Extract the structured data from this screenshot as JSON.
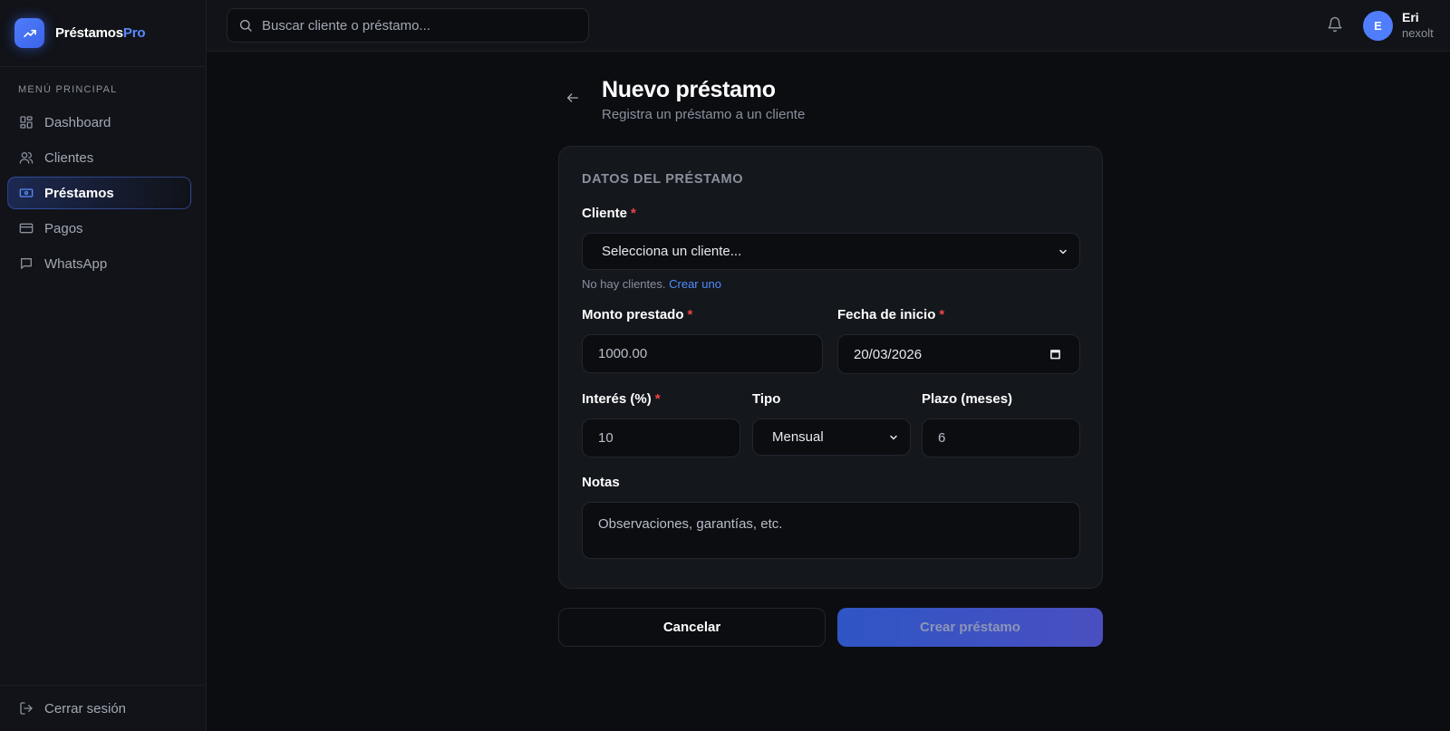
{
  "brand": {
    "name_main": "Préstamos",
    "name_accent": "Pro"
  },
  "sidebar": {
    "section_title": "MENÚ PRINCIPAL",
    "items": [
      {
        "label": "Dashboard",
        "icon": "dashboard-icon"
      },
      {
        "label": "Clientes",
        "icon": "users-icon"
      },
      {
        "label": "Préstamos",
        "icon": "banknote-icon",
        "active": true
      },
      {
        "label": "Pagos",
        "icon": "credit-card-icon"
      },
      {
        "label": "WhatsApp",
        "icon": "message-icon"
      }
    ],
    "logout_label": "Cerrar sesión"
  },
  "topbar": {
    "search_placeholder": "Buscar cliente o préstamo...",
    "user": {
      "initial": "E",
      "name": "Eri",
      "org": "nexolt"
    }
  },
  "page": {
    "title": "Nuevo préstamo",
    "subtitle": "Registra un préstamo a un cliente"
  },
  "form": {
    "section_title": "DATOS DEL PRÉSTAMO",
    "cliente": {
      "label": "Cliente",
      "value": "Selecciona un cliente...",
      "hint_text": "No hay clientes.",
      "hint_link": "Crear uno"
    },
    "monto": {
      "label": "Monto prestado",
      "placeholder": "1000.00"
    },
    "fecha": {
      "label": "Fecha de inicio",
      "value": "20/03/2026"
    },
    "interes": {
      "label": "Interés (%)",
      "placeholder": "10"
    },
    "tipo": {
      "label": "Tipo",
      "value": "Mensual"
    },
    "plazo": {
      "label": "Plazo (meses)",
      "placeholder": "6"
    },
    "notas": {
      "label": "Notas",
      "placeholder": "Observaciones, garantías, etc."
    },
    "required_mark": "*"
  },
  "actions": {
    "cancel_label": "Cancelar",
    "create_label": "Crear préstamo"
  },
  "colors": {
    "background": "#0b0d11",
    "panel": "#14171c",
    "accent": "#4f7dfb",
    "link": "#4f8cff",
    "required": "#ef4444"
  }
}
